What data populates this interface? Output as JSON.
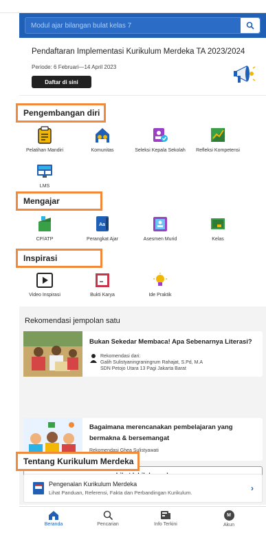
{
  "search": {
    "placeholder": "Modul ajar bilangan bulat kelas 7"
  },
  "banner": {
    "title": "Pendaftaran Implementasi Kurikulum Merdeka TA 2023/2024",
    "period": "Periode: 6 Februari—14 April 2023",
    "button": "Daftar di sini"
  },
  "sections": {
    "pengembangan": {
      "title": "Pengembangan diri",
      "items": [
        "Pelatihan Mandiri",
        "Komunitas",
        "Seleksi Kepala Sekolah",
        "Refleksi Kompetensi",
        "LMS"
      ]
    },
    "mengajar": {
      "title": "Mengajar",
      "items": [
        "CP/ATP",
        "Perangkat Ajar",
        "Asesmen Murid",
        "Kelas"
      ]
    },
    "inspirasi": {
      "title": "Inspirasi",
      "items": [
        "Video Inspirasi",
        "Bukti Karya",
        "Ide Praktik"
      ]
    }
  },
  "rekomendasi": {
    "title": "Rekomendasi jempolan satu",
    "cards": [
      {
        "title": "Bukan Sekedar Membaca! Apa Sebenarnya Literasi?",
        "rec_label": "Rekomendasi dari:",
        "rec_name": "Galih Sulistyaningraningrum Rahajat, S.Pd, M.A",
        "rec_school": "SDN Petojo Utara 13 Pagi Jakarta Barat"
      },
      {
        "title_line1": "Bagaimana merencanakan pembelajaran yang",
        "title_line2": "bermakna & bersemangat",
        "rec": "Rekomendasi Ghea Sulistyawati"
      }
    ],
    "more_button": "Lihat lebih banyak"
  },
  "tentang": {
    "title": "Tentang Kurikulum Merdeka",
    "card_title": "Pengenalan Kurikulum Merdeka",
    "card_sub": "Lihat Panduan, Referensi, Fakta dan Perbandingan Kurikulum."
  },
  "nav": {
    "items": [
      "Beranda",
      "Pencarian",
      "Info Terkini",
      "Akun"
    ],
    "avatar_letter": "M"
  },
  "colors": {
    "primary": "#1f5fb6",
    "highlight": "#f08a3a"
  }
}
